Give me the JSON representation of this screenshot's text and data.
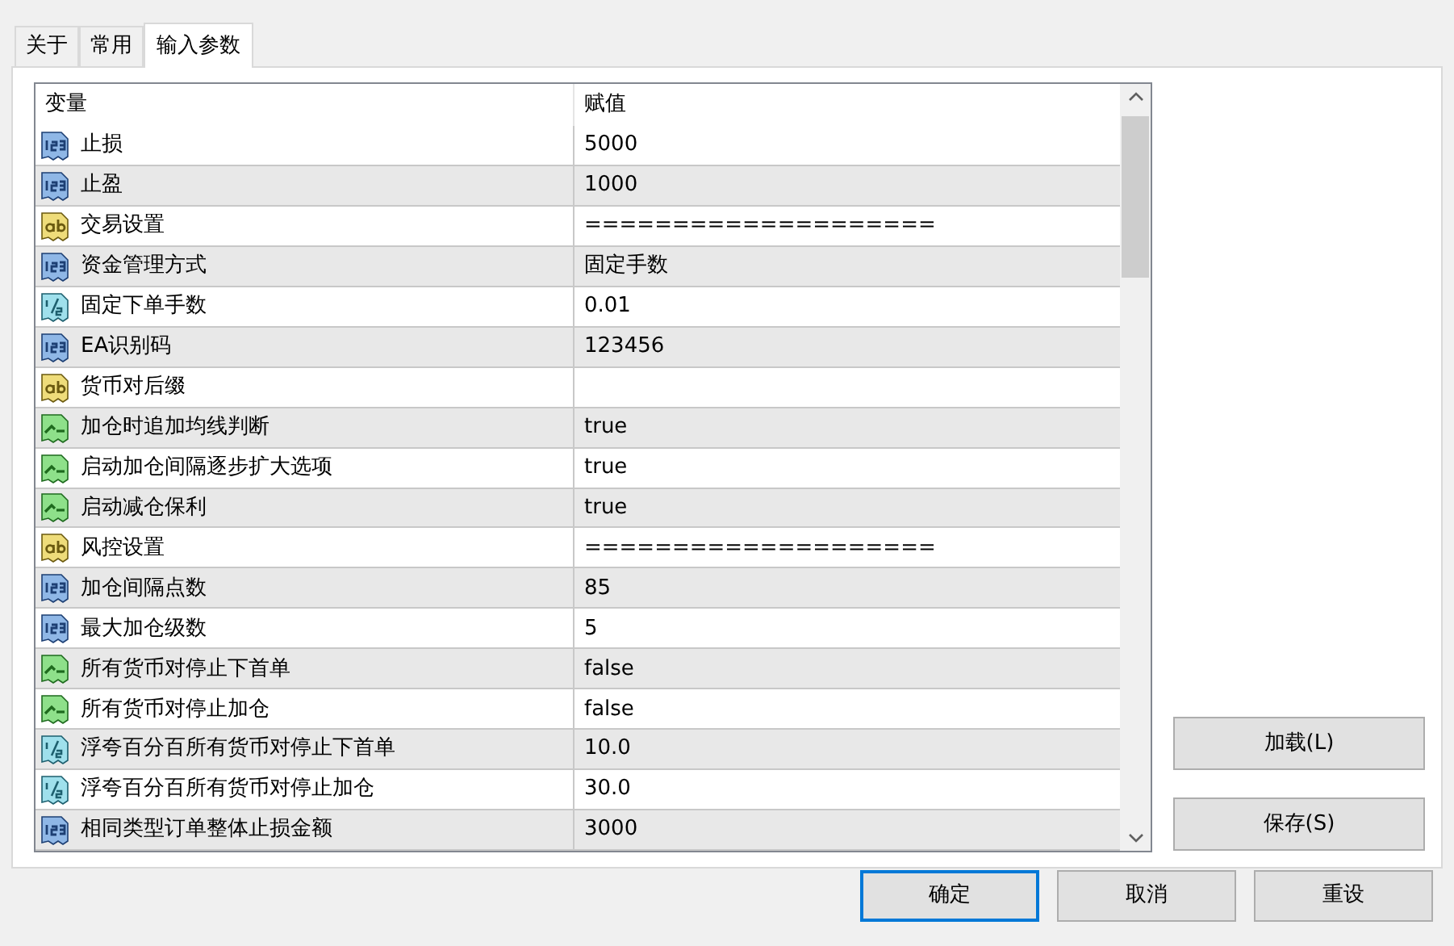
{
  "tabs": [
    {
      "label": "关于",
      "selected": false
    },
    {
      "label": "常用",
      "selected": false
    },
    {
      "label": "输入参数",
      "selected": true
    }
  ],
  "table": {
    "columns": [
      "变量",
      "赋值"
    ],
    "rows": [
      {
        "kind": "int",
        "name": "止损",
        "value": "5000"
      },
      {
        "kind": "int",
        "name": "止盈",
        "value": "1000"
      },
      {
        "kind": "string",
        "name": "交易设置",
        "value": "===================="
      },
      {
        "kind": "int",
        "name": "资金管理方式",
        "value": "固定手数"
      },
      {
        "kind": "double",
        "name": "固定下单手数",
        "value": "0.01"
      },
      {
        "kind": "int",
        "name": "EA识别码",
        "value": "123456"
      },
      {
        "kind": "string",
        "name": "货币对后缀"
      },
      {
        "kind": "bool",
        "name": "加仓时追加均线判断",
        "value": "true"
      },
      {
        "kind": "bool",
        "name": "启动加仓间隔逐步扩大选项",
        "value": "true"
      },
      {
        "kind": "bool",
        "name": "启动减仓保利",
        "value": "true"
      },
      {
        "kind": "string",
        "name": "风控设置",
        "value": "===================="
      },
      {
        "kind": "int",
        "name": "加仓间隔点数",
        "value": "85"
      },
      {
        "kind": "int",
        "name": "最大加仓级数",
        "value": "5"
      },
      {
        "kind": "bool",
        "name": "所有货币对停止下首单",
        "value": "false"
      },
      {
        "kind": "bool",
        "name": "所有货币对停止加仓",
        "value": "false"
      },
      {
        "kind": "double",
        "name": "浮夸百分百所有货币对停止下首单",
        "value": "10.0"
      },
      {
        "kind": "double",
        "name": "浮夸百分百所有货币对停止加仓",
        "value": "30.0"
      },
      {
        "kind": "int",
        "name": "相同类型订单整体止损金额",
        "value": "3000"
      }
    ]
  },
  "side_buttons": [
    "加载(L)",
    "保存(S)"
  ],
  "buttons": [
    {
      "label": "确定",
      "selected": true
    },
    {
      "label": "取消",
      "selected": false
    },
    {
      "label": "重设",
      "selected": false
    }
  ]
}
